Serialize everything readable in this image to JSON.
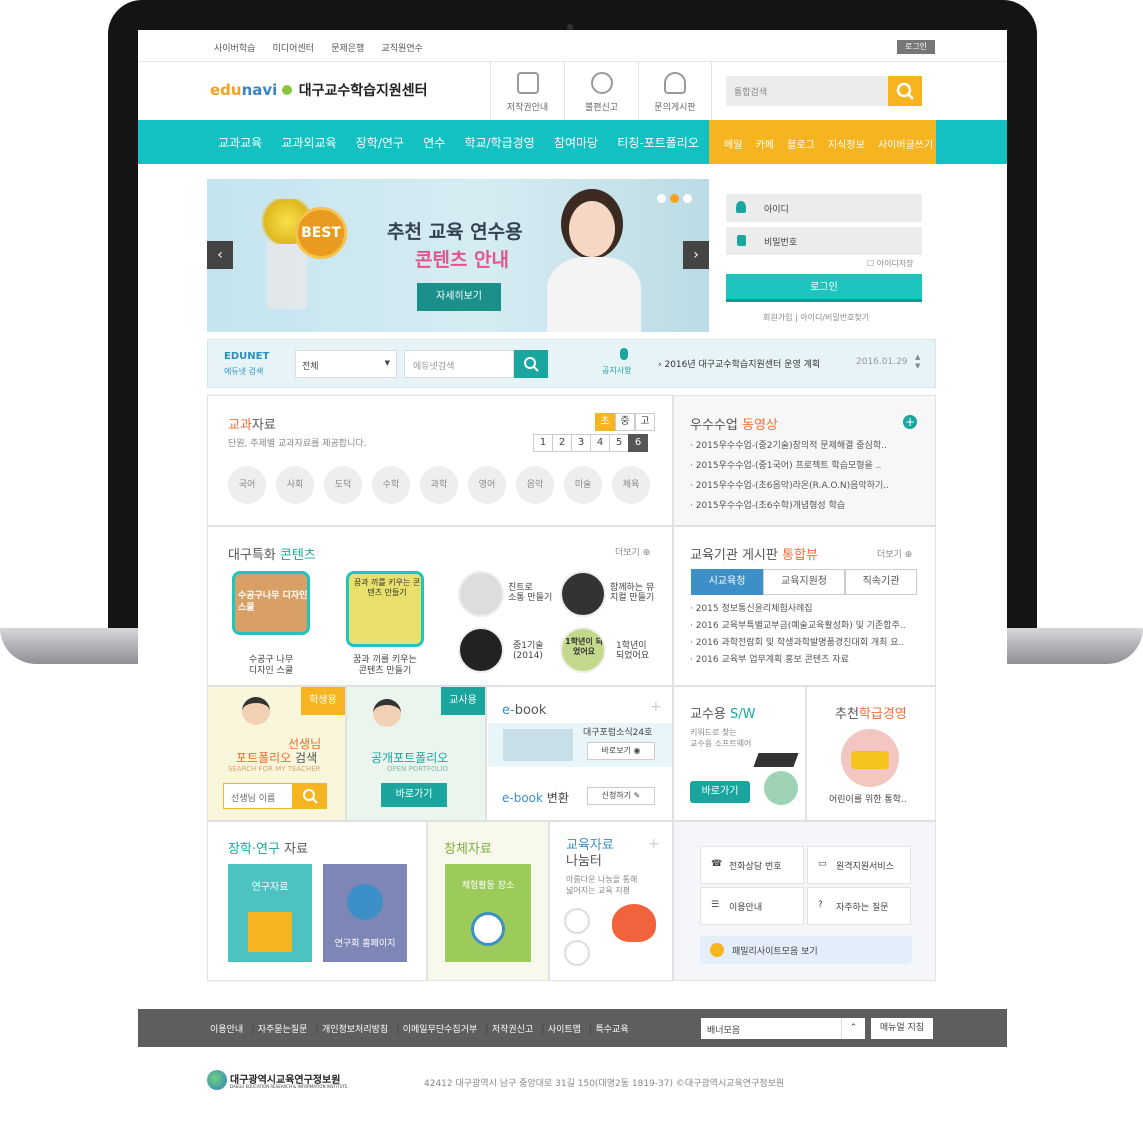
{
  "topnav": {
    "items": [
      "사이버학습",
      "미디어센터",
      "문제은행",
      "교직원연수"
    ],
    "login": "로그인"
  },
  "header": {
    "logo_small": "edunavi",
    "logo_name": "대구교수학습지원센터",
    "icons": [
      "저작권안내",
      "불편신고",
      "문의게시판"
    ],
    "search_placeholder": "통합검색"
  },
  "mainnav": {
    "items": [
      "교과교육",
      "교과외교육",
      "장학/연구",
      "연수",
      "학교/학급경영",
      "참여마당",
      "티칭-포트폴리오"
    ],
    "right_items": [
      "메일",
      "카페",
      "블로그",
      "지식정보",
      "사이버글쓰기"
    ]
  },
  "banner": {
    "badge": "BEST",
    "title1": "추천 교육 연수용",
    "title2": "콘텐츠 안내",
    "button": "자세히보기"
  },
  "login": {
    "id_placeholder": "아이디",
    "pw_placeholder": "비밀번호",
    "save_id": "아이디저장",
    "button": "로그인",
    "join": "회원가입",
    "find": "아이디/비밀번호찾기"
  },
  "edunet": {
    "logo": "EDUNET",
    "sub": "에듀넷 검색",
    "select": "전체",
    "placeholder": "에듀넷검색",
    "notice_label": "공지사항",
    "notice_text": "2016년 대구교수학습지원센터 운영 계획",
    "notice_date": "2016.01.29"
  },
  "subjects": {
    "title_a": "교과",
    "title_b": "자료",
    "desc": "단원, 주제별 교과자료를 제공합니다.",
    "levels": [
      "초",
      "중",
      "고"
    ],
    "grades": [
      "1",
      "2",
      "3",
      "4",
      "5",
      "6"
    ],
    "items": [
      "국어",
      "사회",
      "도덕",
      "수학",
      "과학",
      "영어",
      "음악",
      "미술",
      "체육"
    ]
  },
  "videos": {
    "title_a": "우수수업",
    "title_b": "동영상",
    "items": [
      "2015우수수업-(중2기술)창의적 문제해결 중심학..",
      "2015우수수업-(중1국어) 프로젝트 학습모형을 ..",
      "2015우수수업-(초6음악)라온(R.A.O.N)음악하기..",
      "2015우수수업-(초6수학)개념형성 학습"
    ]
  },
  "special": {
    "title_a": "대구특화",
    "title_b": "콘텐츠",
    "more": "더보기",
    "big": [
      {
        "img": "수공구나무 디자인스쿨",
        "label1": "수공구 나무",
        "label2": "디자인 스쿨"
      },
      {
        "img": "꿈과 끼를 키우는 콘텐츠 만들기",
        "label1": "꿈과 끼를 키우는",
        "label2": "콘텐츠 만들기"
      }
    ],
    "small": [
      {
        "l1": "친트로",
        "l2": "소통 만들기"
      },
      {
        "l1": "함께하는 뮤",
        "l2": "지컬 만들기"
      },
      {
        "l1": "중1기술",
        "l2": "(2014)"
      },
      {
        "l1": "1학년이",
        "l2": "되었어요"
      }
    ],
    "small_img4": "1학년이 되었어요"
  },
  "board": {
    "title_a": "교육기관 게시판",
    "title_b": "통합뷰",
    "more": "더보기",
    "tabs": [
      "시교육청",
      "교육지원청",
      "직속기관"
    ],
    "items": [
      "2015 정보통신윤리체험사례집",
      "2016 교육부특별교부금(예술교육활성화) 및 기존합주..",
      "2016 과학전람회 및 학생과학발명품경진대회 개최 요..",
      "2016 교육부 업무계획 홍보 콘텐츠 자료"
    ]
  },
  "portfolio": {
    "tag1": "학생용",
    "t1a": "선생님",
    "t1b": "포트폴리오",
    "t1c": "검색",
    "sub1": "SEARCH FOR MY TEACHER",
    "input": "선생님 이름",
    "tag2": "교사용",
    "t2": "공개포트폴리오",
    "sub2": "OPEN PORTFOLIO",
    "btn2": "바로가기"
  },
  "ebook": {
    "title_a": "e-",
    "title_b": "book",
    "item": "대구포럼소식24호",
    "view": "바로보기",
    "convert_a": "e-book",
    "convert_b": "변환",
    "apply": "신청하기"
  },
  "sw": {
    "title_a": "교수용",
    "title_b": "S/W",
    "desc1": "키워드로 찾는",
    "desc2": "교수용 소프트웨어",
    "btn": "바로가기"
  },
  "classmg": {
    "title_a": "추천",
    "title_b": "학급경영",
    "caption": "어린이를 위한 통학.."
  },
  "research": {
    "title_a": "장학·연구",
    "title_b": "자료",
    "card1": "연구자료",
    "card2": "연구회 홈페이지"
  },
  "experience": {
    "title": "창체자료",
    "card": "체험활동 장소"
  },
  "share": {
    "title1": "교육자료",
    "title2": "나눔터",
    "desc1": "아름다운 나눔을 통해",
    "desc2": "넓어지는 교육 지평"
  },
  "services": {
    "items": [
      "전화상담 번호",
      "원격지원서비스",
      "이용안내",
      "자주하는 질문"
    ],
    "family": "패밀리사이트모음 보기"
  },
  "footer": {
    "links": [
      "이용안내",
      "자주묻는질문",
      "개인정보처리방침",
      "이메일무단수집거부",
      "저작권신고",
      "사이트맵",
      "특수교육"
    ],
    "banner_select": "배너모음",
    "manual": "매뉴얼 지침",
    "org_name": "대구광역시교육연구정보원",
    "org_eng": "DAEGU EDUCATION RESEARCH & INFORMATION INSTITUTE",
    "address": "42412 대구광역시 남구 중앙대로 31길 150(대명2동 1819-37) ©대구광역시교육연구정보원"
  },
  "colors": {
    "teal": "#13c1c3",
    "orange": "#f6b421",
    "accent_red": "#ef6f3c"
  }
}
